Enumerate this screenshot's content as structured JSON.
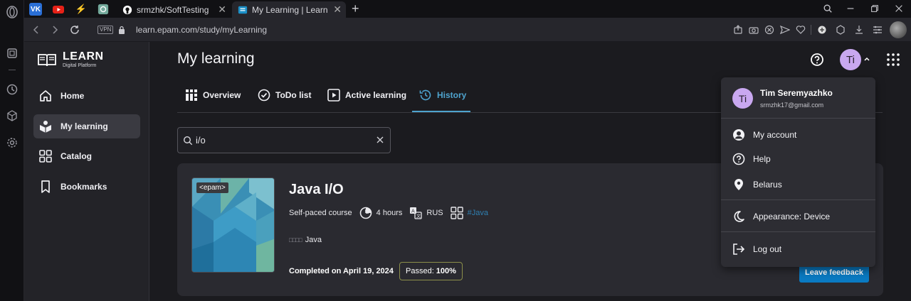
{
  "browser": {
    "tabs": [
      {
        "title": "srmzhk/SoftTesting",
        "icon": "github-icon"
      },
      {
        "title": "My Learning | Learn",
        "icon": "learn-icon",
        "active": true
      }
    ],
    "vpn_label": "VPN",
    "url": "learn.epam.com/study/myLearning"
  },
  "app": {
    "logo_title": "LEARN",
    "logo_subtitle": "Digital Platform",
    "sidebar": [
      {
        "label": "Home",
        "icon": "home-icon"
      },
      {
        "label": "My learning",
        "icon": "my-learning-icon",
        "active": true
      },
      {
        "label": "Catalog",
        "icon": "catalog-icon"
      },
      {
        "label": "Bookmarks",
        "icon": "bookmark-icon"
      }
    ]
  },
  "header": {
    "title": "My learning",
    "avatar_initials": "Ti"
  },
  "tabs": [
    {
      "label": "Overview",
      "icon": "overview-icon"
    },
    {
      "label": "ToDo list",
      "icon": "todo-icon"
    },
    {
      "label": "Active learning",
      "icon": "play-icon"
    },
    {
      "label": "History",
      "icon": "history-icon",
      "active": true
    }
  ],
  "search": {
    "value": "i/o"
  },
  "course": {
    "thumbnail_badge": "<epam>",
    "title": "Java I/O",
    "type": "Self-paced course",
    "duration": "4 hours",
    "language": "RUS",
    "tag": "#Java",
    "skill": "Java",
    "completed": "Completed on April 19, 2024",
    "passed_label": "Passed:",
    "passed_value": "100%",
    "feedback_button": "Leave feedback"
  },
  "profile_menu": {
    "avatar_initials": "Ti",
    "name": "Tim Seremyazhko",
    "email": "srmzhk17@gmail.com",
    "items": [
      {
        "label": "My account",
        "icon": "account-icon"
      },
      {
        "label": "Help",
        "icon": "help-icon"
      },
      {
        "label": "Belarus",
        "icon": "location-pin-icon"
      },
      {
        "label": "Appearance: Device",
        "icon": "moon-icon"
      },
      {
        "label": "Log out",
        "icon": "logout-icon"
      }
    ]
  },
  "colors": {
    "accent": "#4ea3ce",
    "primary_button": "#0a7ac2",
    "avatar": "#c9a8f0"
  }
}
